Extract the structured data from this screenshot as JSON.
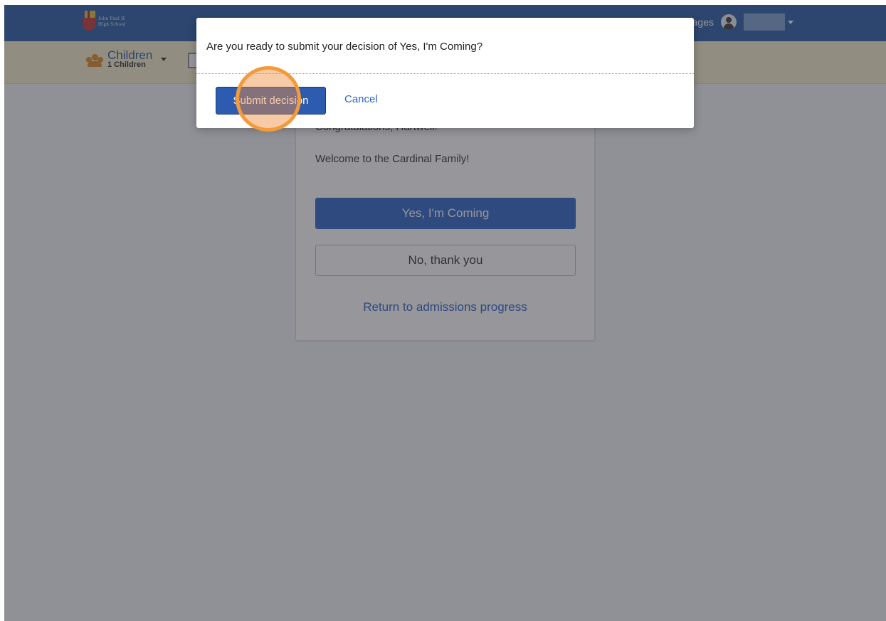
{
  "school": {
    "logo_line1": "John Paul II",
    "logo_line2": "High School",
    "logo_mark": "JPII"
  },
  "topnav": {
    "messages_label": "Messages",
    "username": ""
  },
  "subnav": {
    "children_title": "Children",
    "children_count": "1 Children"
  },
  "card": {
    "congrats": "Congratulations, Hartwell!",
    "welcome": "Welcome to the Cardinal Family!",
    "yes_button": "Yes, I'm Coming",
    "no_button": "No, thank you",
    "return_link": "Return to admissions progress"
  },
  "modal": {
    "message": "Are you ready to submit your decision of Yes, I'm Coming?",
    "submit_label": "Submit decision",
    "cancel_label": "Cancel"
  },
  "colors": {
    "nav_bg": "#2b5ea6",
    "subnav_bg": "#f4ecc9",
    "primary": "#2f66c6",
    "highlight": "#f39a3a"
  },
  "icons": [
    "people-icon",
    "document-icon",
    "user-avatar-icon",
    "caret-down-icon"
  ]
}
